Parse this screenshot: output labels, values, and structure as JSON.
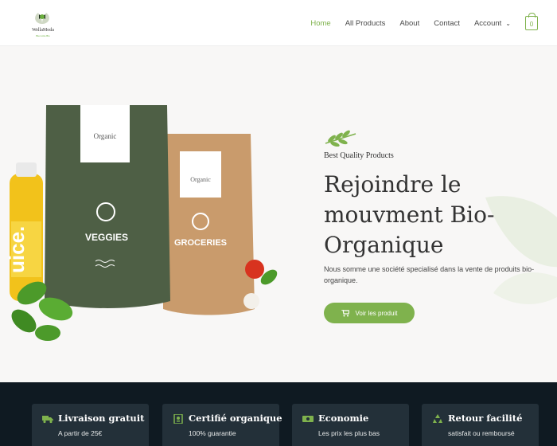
{
  "brand": {
    "name": "WellaModa",
    "tagline": "Bien être Bio"
  },
  "nav": {
    "items": [
      {
        "label": "Home",
        "active": true
      },
      {
        "label": "All Products",
        "active": false
      },
      {
        "label": "About",
        "active": false
      },
      {
        "label": "Contact",
        "active": false
      },
      {
        "label": "Account",
        "active": false
      }
    ],
    "cart_count": "0"
  },
  "hero": {
    "eyebrow": "Best Quality Products",
    "headline_lines": [
      "Rejoindre le",
      "mouvment Bio-",
      "Organique"
    ],
    "description": "Nous somme une société specialisé dans la vente de produits bio-organique.",
    "cta_label": "Voir les produit",
    "product_labels": {
      "bag1_brand": "Organic",
      "bag1_name": "VEGGIES",
      "bag2_brand": "Organic",
      "bag2_name": "GROCERIES",
      "bottle_text": "uice."
    }
  },
  "features": [
    {
      "icon": "truck-icon",
      "title": "Livraison gratuit",
      "subtitle": "A partir de 25€"
    },
    {
      "icon": "certificate-icon",
      "title": "Certifié organique",
      "subtitle": "100% guarantie"
    },
    {
      "icon": "money-icon",
      "title": "Economie",
      "subtitle": "Les prix les plus bas"
    },
    {
      "icon": "recycle-icon",
      "title": "Retour facilité",
      "subtitle": "satisfait ou remboursé"
    }
  ],
  "colors": {
    "accent": "#7fb24d",
    "dark": "#0f1a22",
    "card": "#233039",
    "hero_bg": "#f8f7f6"
  }
}
